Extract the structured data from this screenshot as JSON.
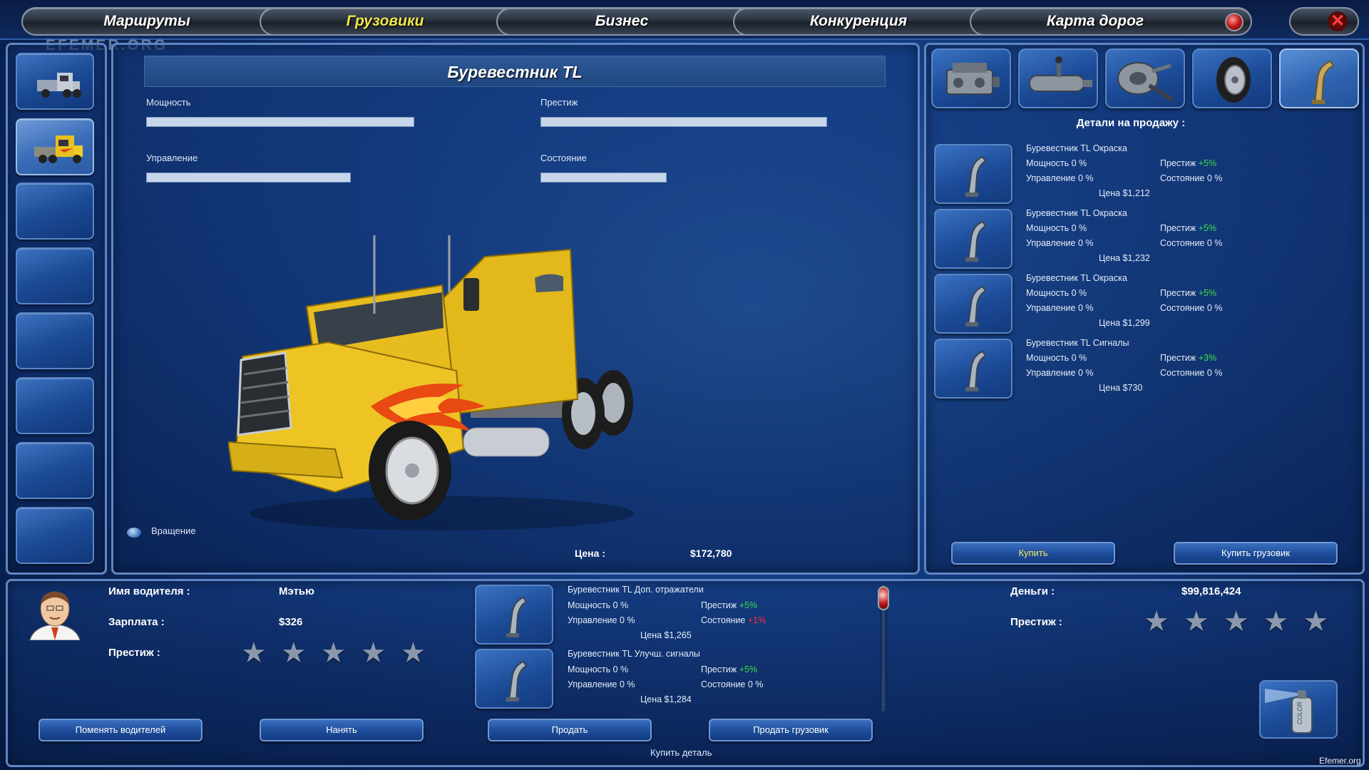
{
  "nav": {
    "tabs": [
      {
        "label": "Маршруты",
        "active": false
      },
      {
        "label": "Грузовики",
        "active": true
      },
      {
        "label": "Бизнес",
        "active": false
      },
      {
        "label": "Конкуренция",
        "active": false
      },
      {
        "label": "Карта дорог",
        "active": false
      }
    ],
    "close_symbol": "✕"
  },
  "watermark_top": "EFEMER.ORG",
  "truck": {
    "name": "Буревестник TL",
    "stats": {
      "power_label": "Мощность",
      "prestige_label": "Престиж",
      "control_label": "Управление",
      "condition_label": "Состояние"
    },
    "stat_fill": {
      "power": 0.72,
      "prestige": 0.77,
      "control": 0.55,
      "condition": 0.34
    },
    "rotate_label": "Вращение",
    "price_label": "Цена :",
    "price": "$172,780"
  },
  "categories": [
    "engine-icon",
    "transmission-icon",
    "suspension-icon",
    "tire-icon",
    "exhaust-icon"
  ],
  "shop": {
    "header": "Детали на продажу :",
    "parts": [
      {
        "name": "Буревестник TL Окраска",
        "power": "Мощность 0 %",
        "prestige_label": "Престиж",
        "prestige_value": "+5%",
        "control": "Управление 0 %",
        "condition": "Состояние 0 %",
        "price": "Цена $1,212"
      },
      {
        "name": "Буревестник TL Окраска",
        "power": "Мощность 0 %",
        "prestige_label": "Престиж",
        "prestige_value": "+5%",
        "control": "Управление 0 %",
        "condition": "Состояние 0 %",
        "price": "Цена $1,232"
      },
      {
        "name": "Буревестник TL Окраска",
        "power": "Мощность 0 %",
        "prestige_label": "Престиж",
        "prestige_value": "+5%",
        "control": "Управление 0 %",
        "condition": "Состояние 0 %",
        "price": "Цена $1,299"
      },
      {
        "name": "Буревестник TL Сигналы",
        "power": "Мощность 0 %",
        "prestige_label": "Престиж",
        "prestige_value": "+3%",
        "control": "Управление 0 %",
        "condition": "Состояние 0 %",
        "price": "Цена $730"
      }
    ],
    "buy_label": "Купить",
    "buy_truck_label": "Купить грузовик"
  },
  "driver": {
    "name_label": "Имя водителя :",
    "name": "Мэтью",
    "salary_label": "Зарплата :",
    "salary": "$326",
    "prestige_label": "Престиж :",
    "stars_filled": 0,
    "stars_total": 5
  },
  "installed": {
    "parts": [
      {
        "name": "Буревестник TL Доп. отражатели",
        "power": "Мощность 0 %",
        "prestige_label": "Престиж",
        "prestige_value": "+5%",
        "control": "Управление 0 %",
        "condition_label": "Состояние",
        "condition_value": "+1%",
        "price": "Цена $1,265"
      },
      {
        "name": "Буревестник TL Улучш. сигналы",
        "power": "Мощность 0 %",
        "prestige_label": "Престиж",
        "prestige_value": "+5%",
        "control": "Управление 0 %",
        "condition_label": "Состояние 0 %",
        "condition_value": "",
        "price": "Цена $1,284"
      }
    ]
  },
  "finance": {
    "money_label": "Деньги :",
    "money": "$99,816,424",
    "prestige_label": "Престиж :",
    "stars_filled": 0,
    "stars_total": 5
  },
  "buttons": {
    "change_drivers": "Поменять водителей",
    "hire": "Нанять",
    "sell": "Продать",
    "sell_truck": "Продать грузовик",
    "paint_can": "COLOR"
  },
  "status_text": "Купить деталь",
  "watermark_bottom": "Efemer.org"
}
